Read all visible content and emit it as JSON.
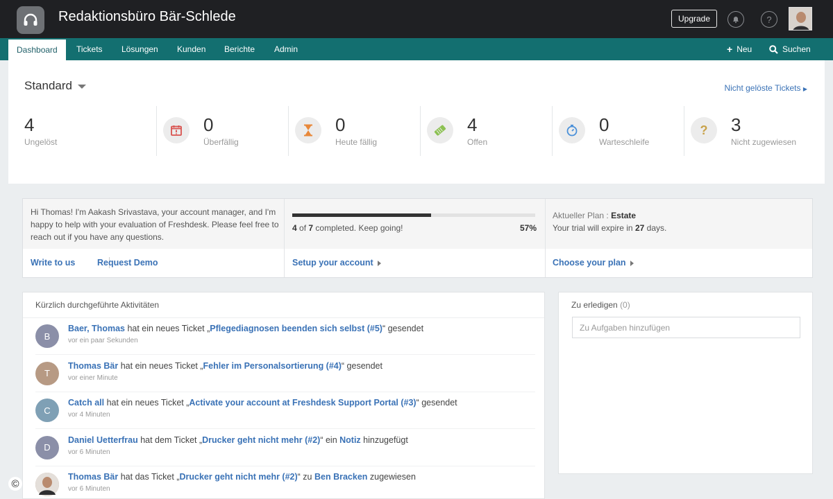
{
  "app": {
    "title": "Redaktionsbüro Bär-Schlede",
    "upgrade_label": "Upgrade",
    "icons": [
      "headset-logo-icon",
      "bell-icon",
      "help-icon",
      "user-avatar"
    ]
  },
  "nav": {
    "items": [
      {
        "label": "Dashboard",
        "active": true
      },
      {
        "label": "Tickets"
      },
      {
        "label": "Lösungen"
      },
      {
        "label": "Kunden"
      },
      {
        "label": "Berichte"
      },
      {
        "label": "Admin"
      }
    ],
    "new_label": "Neu",
    "search_label": "Suchen"
  },
  "dashboard": {
    "view_title": "Standard",
    "unresolved_link": "Nicht gelöste Tickets",
    "stats": [
      {
        "value": "4",
        "label": "Ungelöst",
        "icon": null
      },
      {
        "value": "0",
        "label": "Überfällig",
        "icon": "calendar-alert-icon",
        "color": "#d9534f"
      },
      {
        "value": "0",
        "label": "Heute fällig",
        "icon": "hourglass-icon",
        "color": "#e8883a"
      },
      {
        "value": "4",
        "label": "Offen",
        "icon": "ticket-icon",
        "color": "#8cc152"
      },
      {
        "value": "0",
        "label": "Warteschleife",
        "icon": "stopwatch-icon",
        "color": "#4a90d9"
      },
      {
        "value": "3",
        "label": "Nicht zugewiesen",
        "icon": "question-icon",
        "color": "#c8a24a"
      }
    ]
  },
  "onboarding": {
    "message": "Hi Thomas! I'm Aakash Srivastava, your account manager, and I'm happy to help with your evaluation of Freshdesk. Please feel free to reach out if you have any questions.",
    "write_link": "Write to us",
    "demo_link": "Request Demo",
    "progress_done": "4",
    "progress_total": "7",
    "progress_text": "completed. Keep going!",
    "progress_of": "of",
    "progress_pct": "57%",
    "progress_fraction": 0.57,
    "setup_link": "Setup your account",
    "plan_label": "Aktueller Plan :",
    "plan_value": "Estate",
    "trial_prefix": "Your trial will expire in",
    "trial_days": "27",
    "trial_suffix": "days.",
    "plan_link": "Choose your plan"
  },
  "activities": {
    "header": "Kürzlich durchgeführte Aktivitäten",
    "items": [
      {
        "initial": "B",
        "avatar_color": "#8b8fa8",
        "actor": "Baer, Thomas",
        "t1": " hat ein neues Ticket „",
        "ticket": "Pflegediagnosen beenden sich selbst (#5)",
        "t2": "“ gesendet",
        "extra_link": "",
        "t3": "",
        "time": "vor ein paar Sekunden"
      },
      {
        "initial": "T",
        "avatar_color": "#b79a84",
        "actor": "Thomas Bär",
        "t1": " hat ein neues Ticket „",
        "ticket": "Fehler im Personalsortierung (#4)",
        "t2": "“ gesendet",
        "extra_link": "",
        "t3": "",
        "time": "vor einer Minute"
      },
      {
        "initial": "C",
        "avatar_color": "#7fa0b5",
        "actor": "Catch all",
        "t1": " hat ein neues Ticket „",
        "ticket": "Activate your account at Freshdesk Support Portal (#3)",
        "t2": "“ gesendet",
        "extra_link": "",
        "t3": "",
        "time": "vor 4 Minuten"
      },
      {
        "initial": "D",
        "avatar_color": "#8b8fa8",
        "actor": "Daniel Uetterfrau",
        "t1": " hat dem Ticket „",
        "ticket": "Drucker geht nicht mehr (#2)",
        "t2": "“ ein ",
        "extra_link": "Notiz",
        "t3": " hinzugefügt",
        "time": "vor 6 Minuten"
      },
      {
        "initial": "",
        "avatar_color": "#b08a73",
        "actor": "Thomas Bär",
        "t1": " hat das Ticket „",
        "ticket": "Drucker geht nicht mehr (#2)",
        "t2": "“ zu ",
        "extra_link": "Ben Bracken",
        "t3": " zugewiesen",
        "time": "vor 6 Minuten"
      }
    ]
  },
  "todo": {
    "title": "Zu erledigen",
    "count": "(0)",
    "placeholder": "Zu Aufgaben hinzufügen"
  },
  "copyright_symbol": "©"
}
